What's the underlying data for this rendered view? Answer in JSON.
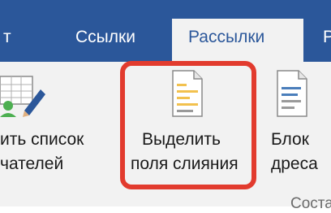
{
  "tabs": {
    "prev_partial": "т",
    "references": "Ссылки",
    "mailings": "Рассылки",
    "next_partial": "Р"
  },
  "buttons": {
    "recipients_line1": "ить список",
    "recipients_line2": "чателей",
    "highlight_line1": "Выделить",
    "highlight_line2": "поля слияния",
    "address_line1": "Блок",
    "address_line2": "дреса"
  },
  "group": {
    "label": "Соста"
  },
  "colors": {
    "tabbar": "#2b579a",
    "ribbon": "#f2f2f2",
    "highlight_border": "#e23b2e"
  },
  "icons": {
    "recipients": "edit-recipient-list-icon",
    "highlight": "highlight-merge-fields-icon",
    "address": "address-block-icon"
  }
}
